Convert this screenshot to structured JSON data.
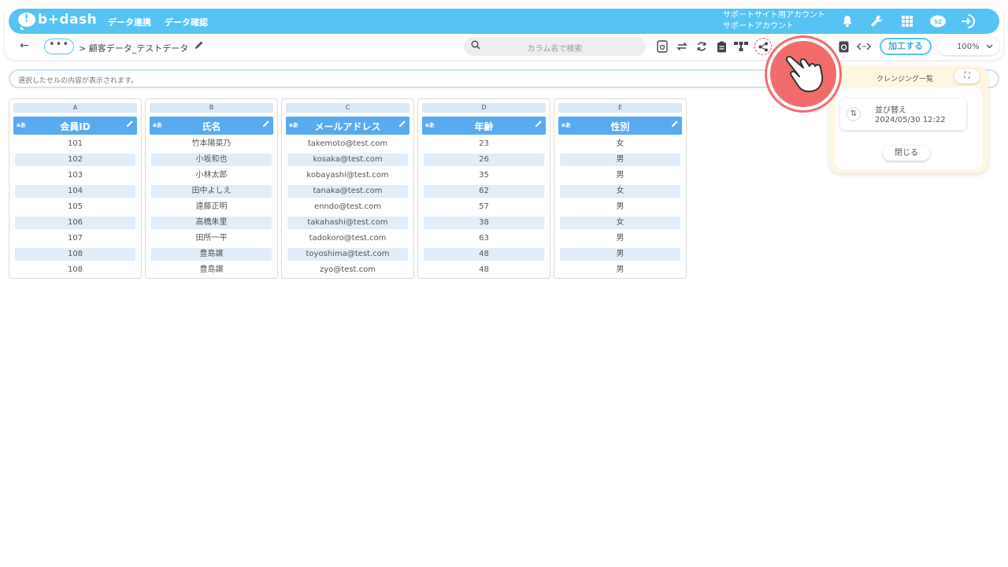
{
  "app": {
    "logo_text": "b+dash",
    "nav": [
      "データ連携",
      "データ確認"
    ],
    "account_line1": "サポートサイト用アカウント",
    "account_line2": "サポートアカウント",
    "avatar_badge": "SZ"
  },
  "toolbar": {
    "back_icon": "←",
    "more_label": "•••",
    "breadcrumb": "> 顧客データ_テストデータ",
    "search_placeholder": "カラム名で検索",
    "process_label": "加工する",
    "zoom_value": "100%"
  },
  "cell_bar": {
    "placeholder": "選択したセルの内容が表示されます。"
  },
  "columns": [
    {
      "letter": "A",
      "type": "aあ",
      "name": "会員ID",
      "cells": [
        "101",
        "102",
        "103",
        "104",
        "105",
        "106",
        "107",
        "108",
        "108"
      ]
    },
    {
      "letter": "B",
      "type": "aあ",
      "name": "氏名",
      "cells": [
        "竹本陽菜乃",
        "小坂和也",
        "小林太郎",
        "田中よしえ",
        "遠藤正明",
        "高橋朱里",
        "田所一平",
        "豊島譲",
        "豊島譲"
      ]
    },
    {
      "letter": "C",
      "type": "aあ",
      "name": "メールアドレス",
      "cells": [
        "takemoto@test.com",
        "kosaka@test.com",
        "kobayashi@test.com",
        "tanaka@test.com",
        "enndo@test.com",
        "takahashi@test.com",
        "tadokoro@test.com",
        "toyoshima@test.com",
        "zyo@test.com"
      ]
    },
    {
      "letter": "D",
      "type": "aあ",
      "name": "年齢",
      "cells": [
        "23",
        "26",
        "35",
        "62",
        "57",
        "38",
        "63",
        "48",
        "48"
      ]
    },
    {
      "letter": "E",
      "type": "aあ",
      "name": "性別",
      "cells": [
        "女",
        "男",
        "男",
        "女",
        "男",
        "女",
        "男",
        "男",
        "男"
      ]
    }
  ],
  "cleansing_panel": {
    "title": "クレンジング一覧",
    "expand_icon": "⛶",
    "history": [
      {
        "label": "並び替え",
        "date": "2024/05/30 12:22"
      }
    ],
    "close_label": "閉じる"
  },
  "colors": {
    "brand": "#56c3f4",
    "header": "#5aaaf0",
    "row_alt": "#e1edf8",
    "panel": "#fef6e0",
    "pointer": "#f26b6b",
    "highlight": "#e24b4b"
  },
  "icons": [
    "bell-icon",
    "wrench-icon",
    "grid-icon",
    "avatar-icon",
    "logout-icon",
    "search-icon",
    "pencil-icon",
    "settings-file-icon",
    "swap-icon",
    "refresh-icon",
    "clipboard-icon",
    "tree-icon",
    "share-icon",
    "history-icon",
    "code-icon",
    "chevron-down-icon",
    "hand-pointer-icon"
  ]
}
